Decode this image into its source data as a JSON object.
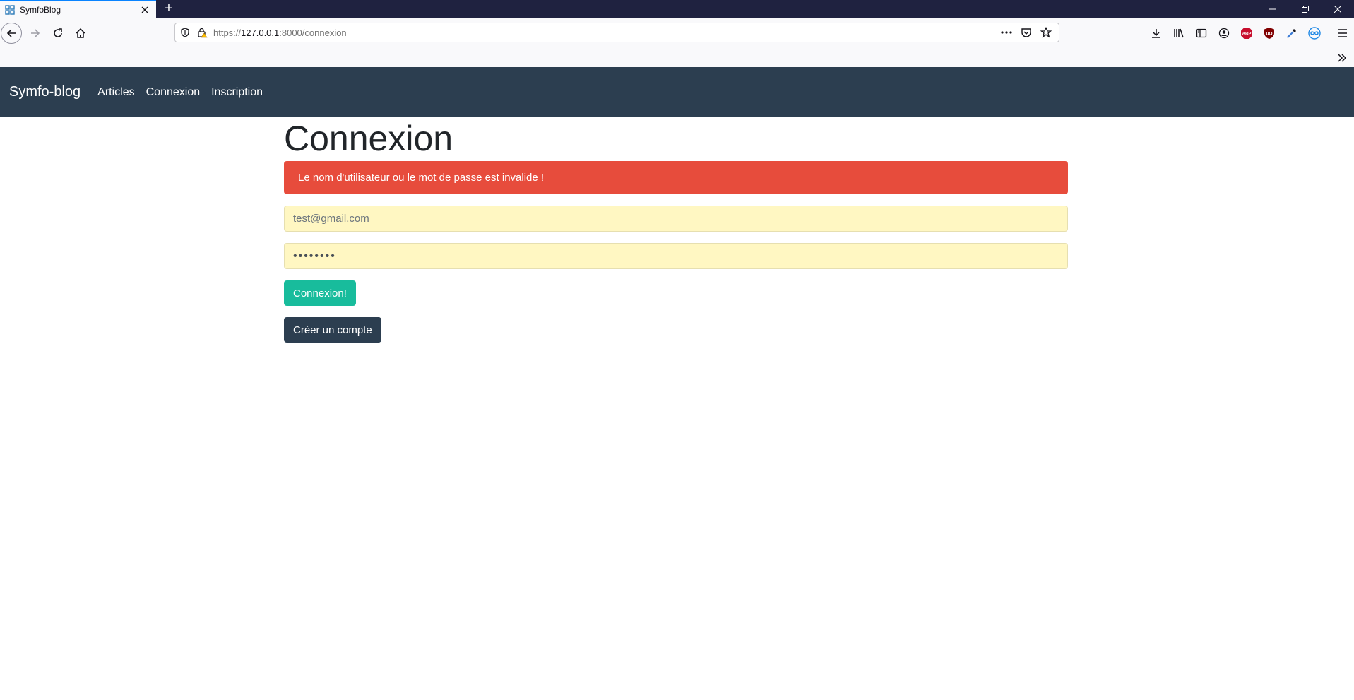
{
  "browser": {
    "tab_title": "SymfoBlog",
    "new_tab_glyph": "+",
    "url_scheme": "https://",
    "url_host": "127.0.0.1",
    "url_rest": ":8000/connexion"
  },
  "site": {
    "brand": "Symfo-blog",
    "nav": {
      "articles": "Articles",
      "connexion": "Connexion",
      "inscription": "Inscription"
    }
  },
  "login": {
    "title": "Connexion",
    "error": "Le nom d'utilisateur ou le mot de passe est invalide !",
    "email_value": "test@gmail.com",
    "password_masked": "••••••••",
    "submit_label": "Connexion!",
    "create_label": "Créer un compte"
  },
  "colors": {
    "navbar": "#2c3e50",
    "alert": "#e74c3c",
    "success": "#18bc9c",
    "autofill": "#fff7c2"
  }
}
